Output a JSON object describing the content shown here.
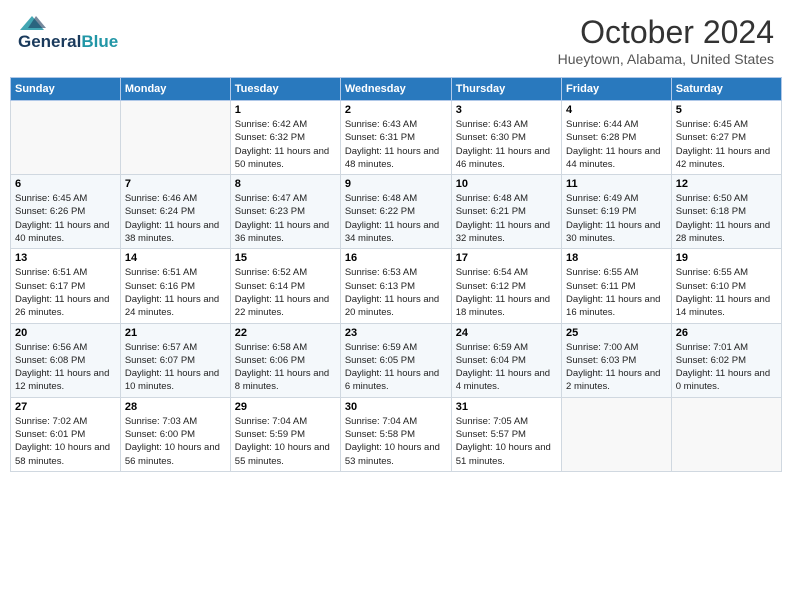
{
  "header": {
    "logo_general": "General",
    "logo_blue": "Blue",
    "month_title": "October 2024",
    "location": "Hueytown, Alabama, United States"
  },
  "weekdays": [
    "Sunday",
    "Monday",
    "Tuesday",
    "Wednesday",
    "Thursday",
    "Friday",
    "Saturday"
  ],
  "weeks": [
    [
      {
        "day": "",
        "sunrise": "",
        "sunset": "",
        "daylight": ""
      },
      {
        "day": "",
        "sunrise": "",
        "sunset": "",
        "daylight": ""
      },
      {
        "day": "1",
        "sunrise": "Sunrise: 6:42 AM",
        "sunset": "Sunset: 6:32 PM",
        "daylight": "Daylight: 11 hours and 50 minutes."
      },
      {
        "day": "2",
        "sunrise": "Sunrise: 6:43 AM",
        "sunset": "Sunset: 6:31 PM",
        "daylight": "Daylight: 11 hours and 48 minutes."
      },
      {
        "day": "3",
        "sunrise": "Sunrise: 6:43 AM",
        "sunset": "Sunset: 6:30 PM",
        "daylight": "Daylight: 11 hours and 46 minutes."
      },
      {
        "day": "4",
        "sunrise": "Sunrise: 6:44 AM",
        "sunset": "Sunset: 6:28 PM",
        "daylight": "Daylight: 11 hours and 44 minutes."
      },
      {
        "day": "5",
        "sunrise": "Sunrise: 6:45 AM",
        "sunset": "Sunset: 6:27 PM",
        "daylight": "Daylight: 11 hours and 42 minutes."
      }
    ],
    [
      {
        "day": "6",
        "sunrise": "Sunrise: 6:45 AM",
        "sunset": "Sunset: 6:26 PM",
        "daylight": "Daylight: 11 hours and 40 minutes."
      },
      {
        "day": "7",
        "sunrise": "Sunrise: 6:46 AM",
        "sunset": "Sunset: 6:24 PM",
        "daylight": "Daylight: 11 hours and 38 minutes."
      },
      {
        "day": "8",
        "sunrise": "Sunrise: 6:47 AM",
        "sunset": "Sunset: 6:23 PM",
        "daylight": "Daylight: 11 hours and 36 minutes."
      },
      {
        "day": "9",
        "sunrise": "Sunrise: 6:48 AM",
        "sunset": "Sunset: 6:22 PM",
        "daylight": "Daylight: 11 hours and 34 minutes."
      },
      {
        "day": "10",
        "sunrise": "Sunrise: 6:48 AM",
        "sunset": "Sunset: 6:21 PM",
        "daylight": "Daylight: 11 hours and 32 minutes."
      },
      {
        "day": "11",
        "sunrise": "Sunrise: 6:49 AM",
        "sunset": "Sunset: 6:19 PM",
        "daylight": "Daylight: 11 hours and 30 minutes."
      },
      {
        "day": "12",
        "sunrise": "Sunrise: 6:50 AM",
        "sunset": "Sunset: 6:18 PM",
        "daylight": "Daylight: 11 hours and 28 minutes."
      }
    ],
    [
      {
        "day": "13",
        "sunrise": "Sunrise: 6:51 AM",
        "sunset": "Sunset: 6:17 PM",
        "daylight": "Daylight: 11 hours and 26 minutes."
      },
      {
        "day": "14",
        "sunrise": "Sunrise: 6:51 AM",
        "sunset": "Sunset: 6:16 PM",
        "daylight": "Daylight: 11 hours and 24 minutes."
      },
      {
        "day": "15",
        "sunrise": "Sunrise: 6:52 AM",
        "sunset": "Sunset: 6:14 PM",
        "daylight": "Daylight: 11 hours and 22 minutes."
      },
      {
        "day": "16",
        "sunrise": "Sunrise: 6:53 AM",
        "sunset": "Sunset: 6:13 PM",
        "daylight": "Daylight: 11 hours and 20 minutes."
      },
      {
        "day": "17",
        "sunrise": "Sunrise: 6:54 AM",
        "sunset": "Sunset: 6:12 PM",
        "daylight": "Daylight: 11 hours and 18 minutes."
      },
      {
        "day": "18",
        "sunrise": "Sunrise: 6:55 AM",
        "sunset": "Sunset: 6:11 PM",
        "daylight": "Daylight: 11 hours and 16 minutes."
      },
      {
        "day": "19",
        "sunrise": "Sunrise: 6:55 AM",
        "sunset": "Sunset: 6:10 PM",
        "daylight": "Daylight: 11 hours and 14 minutes."
      }
    ],
    [
      {
        "day": "20",
        "sunrise": "Sunrise: 6:56 AM",
        "sunset": "Sunset: 6:08 PM",
        "daylight": "Daylight: 11 hours and 12 minutes."
      },
      {
        "day": "21",
        "sunrise": "Sunrise: 6:57 AM",
        "sunset": "Sunset: 6:07 PM",
        "daylight": "Daylight: 11 hours and 10 minutes."
      },
      {
        "day": "22",
        "sunrise": "Sunrise: 6:58 AM",
        "sunset": "Sunset: 6:06 PM",
        "daylight": "Daylight: 11 hours and 8 minutes."
      },
      {
        "day": "23",
        "sunrise": "Sunrise: 6:59 AM",
        "sunset": "Sunset: 6:05 PM",
        "daylight": "Daylight: 11 hours and 6 minutes."
      },
      {
        "day": "24",
        "sunrise": "Sunrise: 6:59 AM",
        "sunset": "Sunset: 6:04 PM",
        "daylight": "Daylight: 11 hours and 4 minutes."
      },
      {
        "day": "25",
        "sunrise": "Sunrise: 7:00 AM",
        "sunset": "Sunset: 6:03 PM",
        "daylight": "Daylight: 11 hours and 2 minutes."
      },
      {
        "day": "26",
        "sunrise": "Sunrise: 7:01 AM",
        "sunset": "Sunset: 6:02 PM",
        "daylight": "Daylight: 11 hours and 0 minutes."
      }
    ],
    [
      {
        "day": "27",
        "sunrise": "Sunrise: 7:02 AM",
        "sunset": "Sunset: 6:01 PM",
        "daylight": "Daylight: 10 hours and 58 minutes."
      },
      {
        "day": "28",
        "sunrise": "Sunrise: 7:03 AM",
        "sunset": "Sunset: 6:00 PM",
        "daylight": "Daylight: 10 hours and 56 minutes."
      },
      {
        "day": "29",
        "sunrise": "Sunrise: 7:04 AM",
        "sunset": "Sunset: 5:59 PM",
        "daylight": "Daylight: 10 hours and 55 minutes."
      },
      {
        "day": "30",
        "sunrise": "Sunrise: 7:04 AM",
        "sunset": "Sunset: 5:58 PM",
        "daylight": "Daylight: 10 hours and 53 minutes."
      },
      {
        "day": "31",
        "sunrise": "Sunrise: 7:05 AM",
        "sunset": "Sunset: 5:57 PM",
        "daylight": "Daylight: 10 hours and 51 minutes."
      },
      {
        "day": "",
        "sunrise": "",
        "sunset": "",
        "daylight": ""
      },
      {
        "day": "",
        "sunrise": "",
        "sunset": "",
        "daylight": ""
      }
    ]
  ]
}
